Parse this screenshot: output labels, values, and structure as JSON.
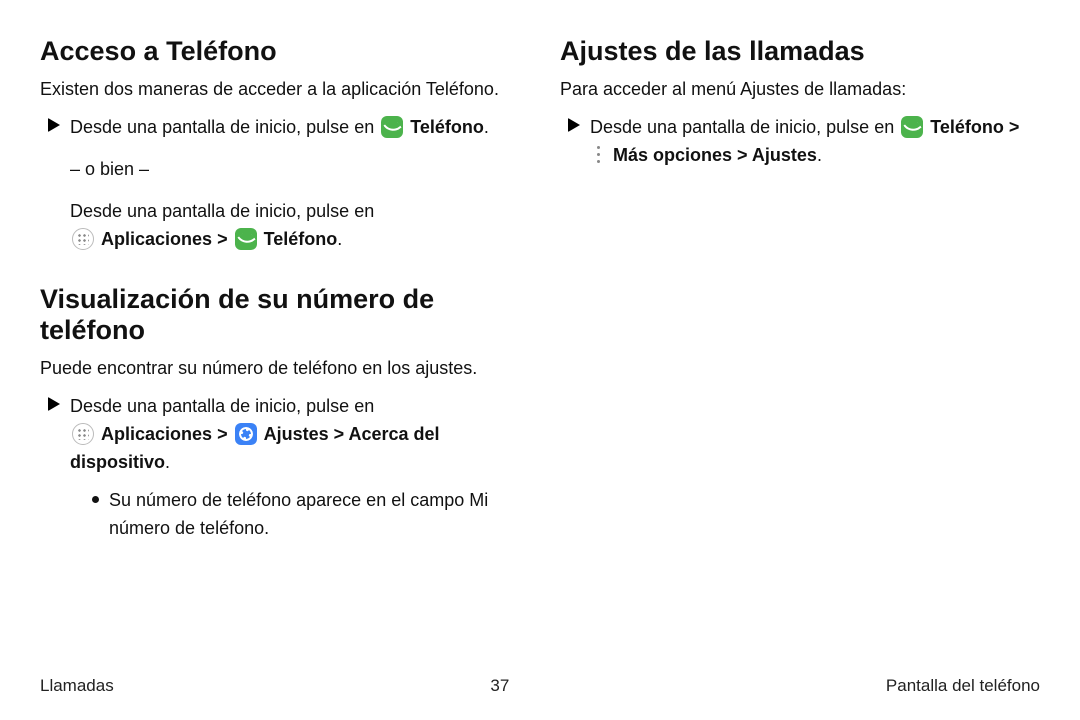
{
  "left": {
    "section1": {
      "heading": "Acceso a Teléfono",
      "intro": "Existen dos maneras de acceder a la aplicación Teléfono.",
      "step_prefix": "Desde una pantalla de inicio, pulse en",
      "phone_label": "Teléfono",
      "period": ".",
      "or": "– o bien –",
      "alt_prefix": "Desde una pantalla de inicio, pulse en",
      "apps_label": "Aplicaciones",
      "caret": " > "
    },
    "section2": {
      "heading": "Visualización de su número de teléfono",
      "intro": "Puede encontrar su número de teléfono en los ajustes.",
      "step_prefix": "Desde una pantalla de inicio, pulse en",
      "apps_label": "Aplicaciones",
      "caret1": " > ",
      "settings_label": "Ajustes",
      "caret2": " > ",
      "about_label": "Acerca del dispositivo",
      "period": ".",
      "bullet": "Su número de teléfono aparece en el campo Mi número de teléfono."
    }
  },
  "right": {
    "heading": "Ajustes de las llamadas",
    "intro": "Para acceder al menú Ajustes de llamadas:",
    "step_prefix": "Desde una pantalla de inicio, pulse en",
    "phone_label": "Teléfono",
    "caret1": " > ",
    "more_label": "Más opciones",
    "caret2": " > ",
    "settings_label": "Ajustes",
    "period": "."
  },
  "footer": {
    "left": "Llamadas",
    "center": "37",
    "right": "Pantalla del teléfono"
  }
}
